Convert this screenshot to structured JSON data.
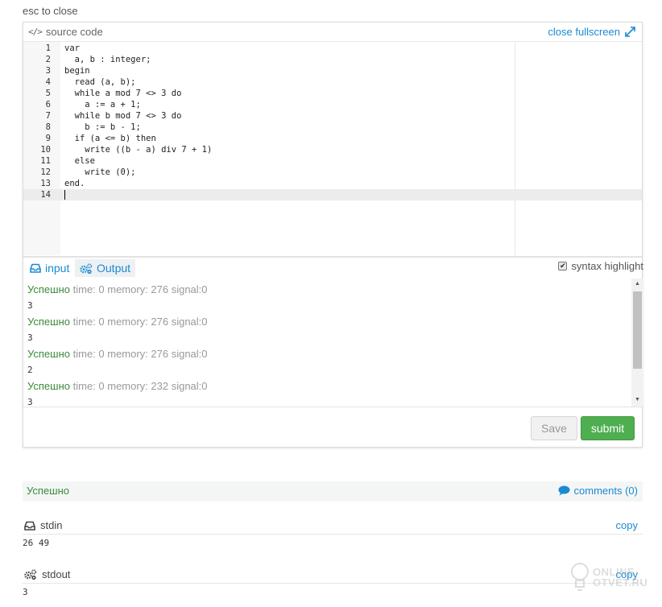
{
  "hint": "esc to close",
  "header": {
    "source_label": "source code",
    "close_fullscreen": "close fullscreen"
  },
  "editor": {
    "lines": [
      {
        "n": "1",
        "t": "var"
      },
      {
        "n": "2",
        "t": "  a, b : integer;"
      },
      {
        "n": "3",
        "t": "begin"
      },
      {
        "n": "4",
        "t": "  read (a, b);"
      },
      {
        "n": "5",
        "t": "  while a mod 7 <> 3 do"
      },
      {
        "n": "6",
        "t": "    a := a + 1;"
      },
      {
        "n": "7",
        "t": "  while b mod 7 <> 3 do"
      },
      {
        "n": "8",
        "t": "    b := b - 1;"
      },
      {
        "n": "9",
        "t": "  if (a <= b) then"
      },
      {
        "n": "10",
        "t": "    write ((b - a) div 7 + 1)"
      },
      {
        "n": "11",
        "t": "  else"
      },
      {
        "n": "12",
        "t": "    write (0);"
      },
      {
        "n": "13",
        "t": "end."
      },
      {
        "n": "14",
        "t": ""
      }
    ]
  },
  "tabs": {
    "input": "input",
    "output": "Output"
  },
  "syntax_highlight": {
    "label": "syntax highlight",
    "checked": true
  },
  "output": {
    "entries": [
      {
        "status": "Успешно",
        "meta": " time: 0 memory: 276 signal:0",
        "value": "3"
      },
      {
        "status": "Успешно",
        "meta": " time: 0 memory: 276 signal:0",
        "value": "3"
      },
      {
        "status": "Успешно",
        "meta": " time: 0 memory: 276 signal:0",
        "value": "2"
      },
      {
        "status": "Успешно",
        "meta": " time: 0 memory: 232 signal:0",
        "value": "3"
      }
    ]
  },
  "buttons": {
    "save": "Save",
    "submit": "submit"
  },
  "result": {
    "status": "Успешно",
    "comments": "comments (0)"
  },
  "stdin": {
    "title": "stdin",
    "copy": "copy",
    "value": "26 49"
  },
  "stdout": {
    "title": "stdout",
    "copy": "copy",
    "value": "3"
  },
  "watermark": {
    "line1": "ONLINE",
    "line2": "OTVET.RU"
  },
  "colors": {
    "accent": "#1a8ad1",
    "success": "#3b8a3b",
    "submit_bg": "#4fae4f"
  }
}
